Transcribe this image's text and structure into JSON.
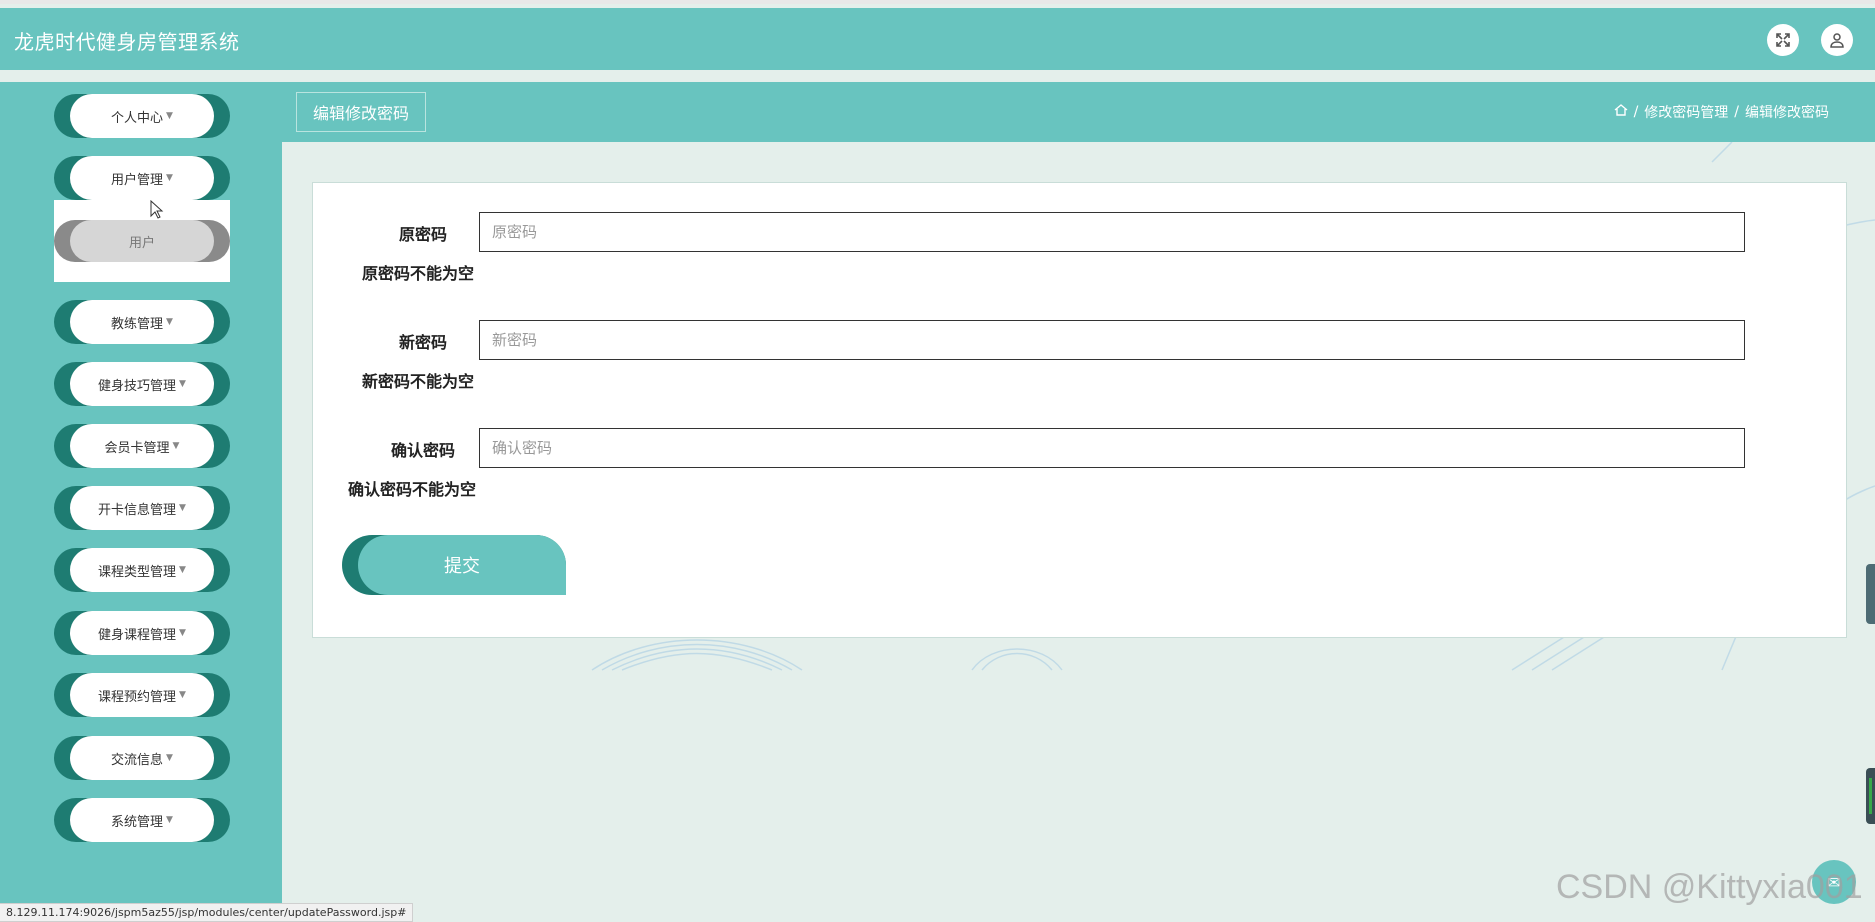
{
  "app": {
    "title": "龙虎时代健身房管理系统"
  },
  "topbar": {
    "icons": [
      "fullscreen-icon",
      "user-icon"
    ]
  },
  "sidebar": {
    "items": [
      {
        "label": "个人中心"
      },
      {
        "label": "用户管理"
      },
      {
        "label": "教练管理"
      },
      {
        "label": "健身技巧管理"
      },
      {
        "label": "会员卡管理"
      },
      {
        "label": "开卡信息管理"
      },
      {
        "label": "课程类型管理"
      },
      {
        "label": "健身课程管理"
      },
      {
        "label": "课程预约管理"
      },
      {
        "label": "交流信息"
      },
      {
        "label": "系统管理"
      }
    ],
    "submenu": {
      "parent": "用户管理",
      "items": [
        {
          "label": "用户"
        }
      ]
    }
  },
  "header": {
    "tab_label": "编辑修改密码",
    "breadcrumb": {
      "separator": "/",
      "items": [
        "修改密码管理",
        "编辑修改密码"
      ]
    }
  },
  "form": {
    "fields": [
      {
        "label": "原密码",
        "placeholder": "原密码",
        "value": "",
        "error": "原密码不能为空"
      },
      {
        "label": "新密码",
        "placeholder": "新密码",
        "value": "",
        "error": "新密码不能为空"
      },
      {
        "label": "确认密码",
        "placeholder": "确认密码",
        "value": "",
        "error": "确认密码不能为空"
      }
    ],
    "submit_label": "提交"
  },
  "status_bar": {
    "url": "8.129.11.174:9026/jspm5az55/jsp/modules/center/updatePassword.jsp#"
  },
  "watermark": "CSDN @Kittyxia001",
  "colors": {
    "primary": "#68c4bf",
    "primary_dark": "#1e7c72",
    "background": "#e4efeb"
  }
}
